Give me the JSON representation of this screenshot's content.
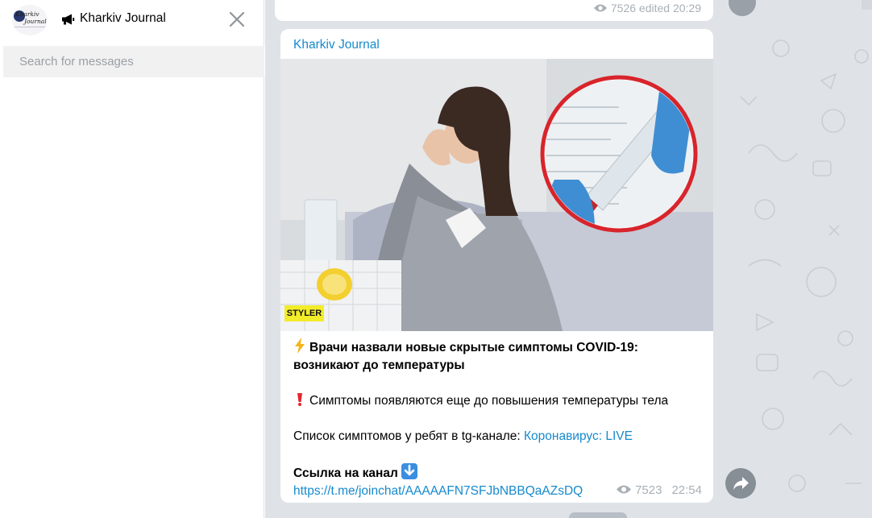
{
  "sidebar": {
    "channel_name": "Kharkiv Journal",
    "avatar_text_line1": "Kharkiv",
    "avatar_text_line2": "Journal",
    "search_placeholder": "Search for messages",
    "icons": {
      "channel_type": "megaphone-icon",
      "close": "close-icon"
    }
  },
  "previous_message": {
    "views": "7526",
    "time": "edited 20:29"
  },
  "message": {
    "author": "Kharkiv Journal",
    "photo_logo": "STYLER",
    "headline": "Врачи назвали новые скрытые симптомы COVID-19: возникают до температуры",
    "symptom_line": "Симптомы появляются еще до повышения температуры тела",
    "list_prefix": "Список симптомов у ребят в tg-канале: ",
    "list_link": "Коронавирус: LIVE",
    "channel_link_label": "Ссылка на канал",
    "invite_url": "https://t.me/joinchat/AAAAAFN7SFJbNBBQaAZsDQ",
    "views": "7523",
    "time": "22:54",
    "icons": {
      "headline": "lightning-emoji",
      "symptom": "exclamation-emoji",
      "link": "down-arrow-emoji",
      "views": "eye-icon",
      "share": "share-icon"
    }
  },
  "colors": {
    "accent": "#168acd",
    "chat_background": "#dfe3e7",
    "meta_text": "#a9b0b5"
  }
}
